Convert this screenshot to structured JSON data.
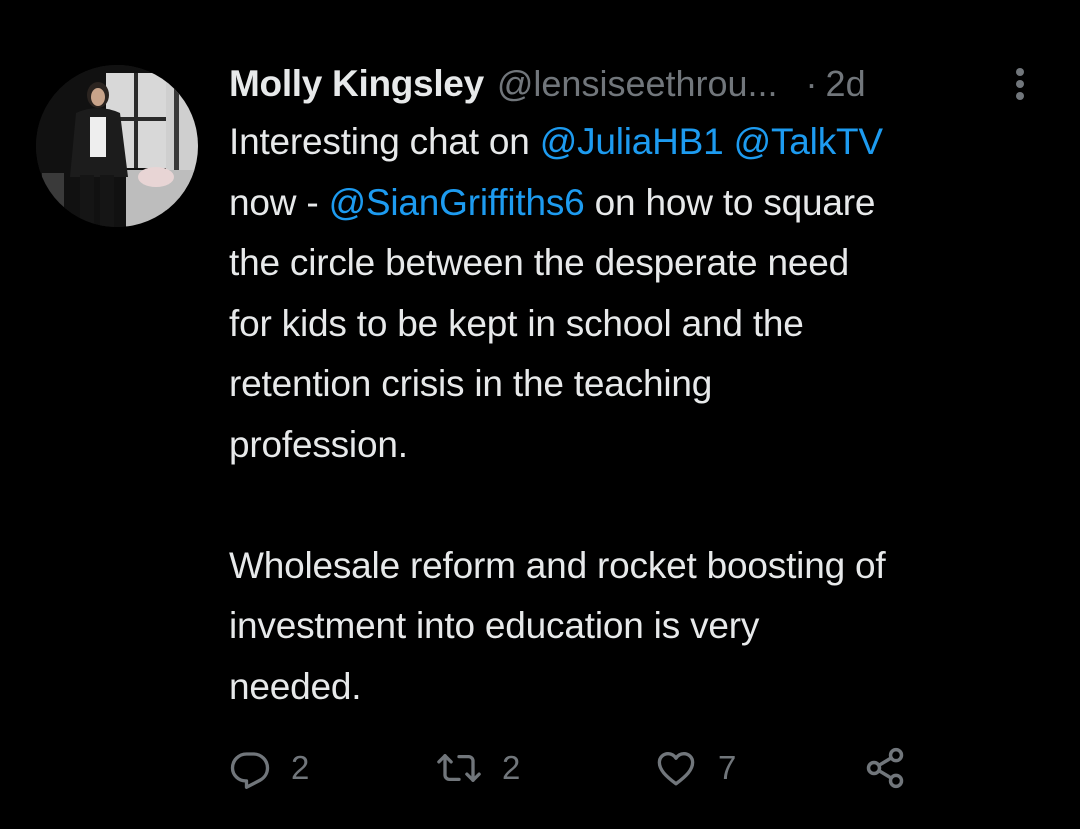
{
  "tweet": {
    "author_name": "Molly Kingsley",
    "author_handle": "@lensiseethrou...",
    "separator": "·",
    "time_ago": "2d",
    "body_lines": [
      [
        {
          "text": "Interesting chat on ",
          "mention": false
        },
        {
          "text": "@JuliaHB1",
          "mention": true
        },
        {
          "text": " ",
          "mention": false
        },
        {
          "text": "@TalkTV",
          "mention": true
        }
      ],
      [
        {
          "text": "now - ",
          "mention": false
        },
        {
          "text": "@SianGriffiths6",
          "mention": true
        },
        {
          "text": " on how to square",
          "mention": false
        }
      ],
      [
        {
          "text": "the circle between the desperate need",
          "mention": false
        }
      ],
      [
        {
          "text": "for kids to be kept in school and the",
          "mention": false
        }
      ],
      [
        {
          "text": "retention crisis in the teaching",
          "mention": false
        }
      ],
      [
        {
          "text": "profession.",
          "mention": false
        }
      ]
    ],
    "body_lines_2": [
      [
        {
          "text": "Wholesale reform and rocket boosting of",
          "mention": false
        }
      ],
      [
        {
          "text": "investment into education is very",
          "mention": false
        }
      ],
      [
        {
          "text": "needed.",
          "mention": false
        }
      ]
    ],
    "actions": {
      "reply_count": "2",
      "retweet_count": "2",
      "like_count": "7"
    }
  },
  "icons": {
    "more": "more-vertical-icon",
    "reply": "reply-icon",
    "retweet": "retweet-icon",
    "like": "heart-icon",
    "share": "share-icon"
  },
  "colors": {
    "background": "#000000",
    "text": "#e7e9ea",
    "secondary": "#71767b",
    "mention": "#1d9bf0"
  }
}
